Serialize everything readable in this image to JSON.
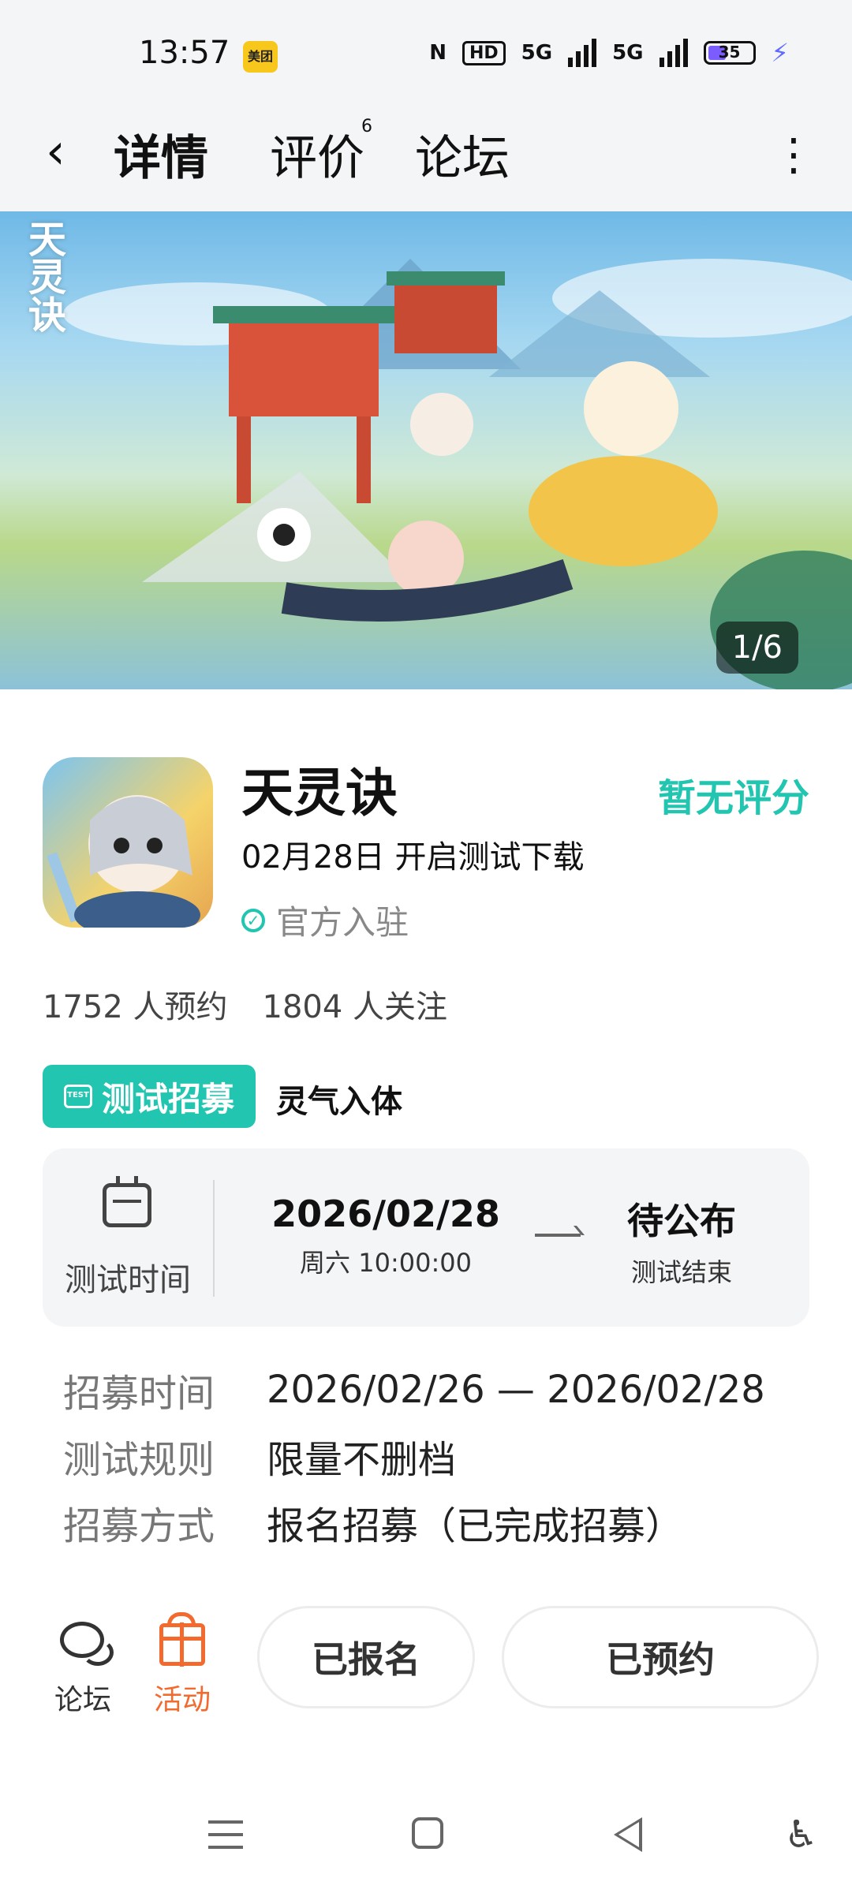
{
  "status_bar": {
    "time": "13:57",
    "app_badge": "美团",
    "nfc": "N",
    "hd": "HD",
    "net1": "5G",
    "net2": "5G",
    "battery": "35"
  },
  "header": {
    "tabs": [
      {
        "label": "详情",
        "active": true
      },
      {
        "label": "评价",
        "badge": "6"
      },
      {
        "label": "论坛"
      }
    ]
  },
  "banner": {
    "logo_text": "天灵诀",
    "counter": "1/6"
  },
  "game": {
    "name": "天灵诀",
    "rating": "暂无评分",
    "subtitle": "02月28日 开启测试下载",
    "official": "官方入驻",
    "reservations": "1752 人预约",
    "follows": "1804 人关注",
    "test_tag": "测试招募",
    "test_name": "灵气入体"
  },
  "test_card": {
    "label": "测试时间",
    "start_date": "2026/02/28",
    "start_time": "周六  10:00:00",
    "end_date": "待公布",
    "end_label": "测试结束"
  },
  "info": [
    {
      "key": "招募时间",
      "value": "2026/02/26 — 2026/02/28"
    },
    {
      "key": "测试规则",
      "value": "限量不删档"
    },
    {
      "key": "招募方式",
      "value": "报名招募（已完成招募）"
    }
  ],
  "bottom_bar": {
    "forum_label": "论坛",
    "activity_label": "活动",
    "signed_up": "已报名",
    "reserved": "已预约"
  },
  "colors": {
    "accent": "#22c5b0",
    "activity": "#f26a2e"
  }
}
